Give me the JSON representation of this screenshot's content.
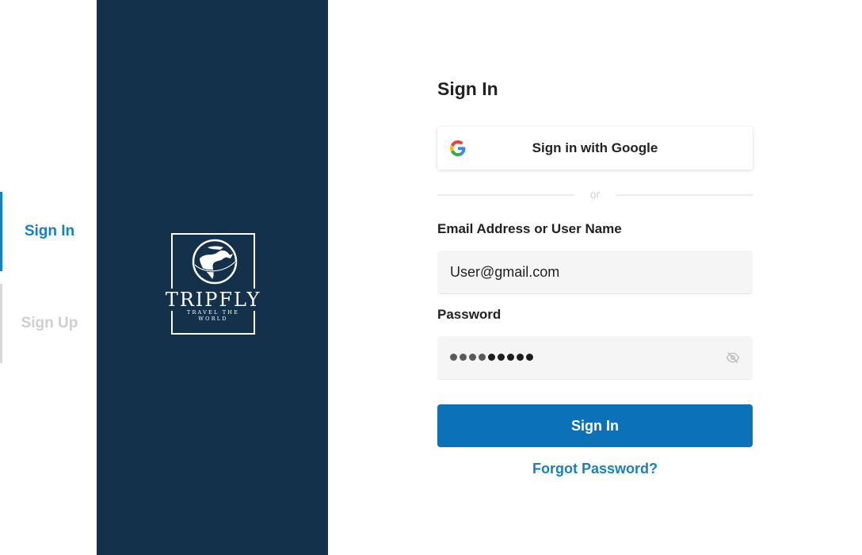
{
  "tabs": {
    "sign_in": "Sign In",
    "sign_up": "Sign Up"
  },
  "brand": {
    "name": "TRIPFLY",
    "tagline": "TRAVEL THE WORLD",
    "logo_icon": "globe-plane-icon"
  },
  "form": {
    "title": "Sign In",
    "google_button": "Sign in with Google",
    "divider_text": "or",
    "email_label": "Email Address or User Name",
    "email_value": "User@gmail.com",
    "password_label": "Password",
    "password_mask_length": 9,
    "submit_label": "Sign In",
    "forgot_link": "Forgot Password?"
  },
  "colors": {
    "brand_panel": "#13314a",
    "accent": "#1a7fbd",
    "primary_button": "#0b72b9"
  }
}
